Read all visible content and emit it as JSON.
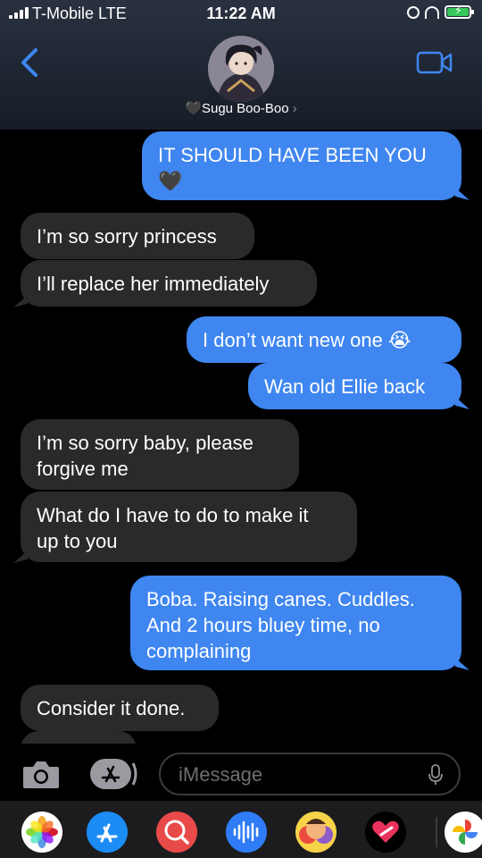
{
  "status_bar": {
    "carrier": "T-Mobile  LTE",
    "time": "11:22 AM",
    "icons": [
      "signal-icon",
      "alarm-icon",
      "headphones-icon",
      "battery-charging-icon"
    ]
  },
  "contact": {
    "name": "Sugu Boo-Boo",
    "name_prefix_icon": "black-heart-emoji",
    "chevron": "›"
  },
  "messages": [
    {
      "side": "sent",
      "text": "IT SHOULD HAVE BEEN YOU\n🖤"
    },
    {
      "side": "received",
      "text": "I’m so sorry princess"
    },
    {
      "side": "received",
      "text": "I’ll replace her immediately"
    },
    {
      "side": "sent",
      "text": "I don’t want new one 😭"
    },
    {
      "side": "sent",
      "text": "Wan old Ellie back"
    },
    {
      "side": "received",
      "text": "I’m so sorry baby, please\nforgive me"
    },
    {
      "side": "received",
      "text": "What do I have to do to make it\nup to you"
    },
    {
      "side": "sent",
      "text": "Boba. Raising canes. Cuddles.\nAnd 2 hours bluey time, no\ncomplaining"
    },
    {
      "side": "received",
      "text": "Consider it done."
    }
  ],
  "input": {
    "placeholder": "iMessage"
  },
  "app_strip": [
    "photos-app-icon",
    "app-store-icon",
    "images-search-icon",
    "audio-message-icon",
    "memoji-stickers-icon",
    "digital-touch-icon",
    "google-photos-icon"
  ],
  "colors": {
    "sent_bubble": "#3f86f0",
    "received_bubble": "#2a2a2d",
    "battery": "#35c759"
  }
}
